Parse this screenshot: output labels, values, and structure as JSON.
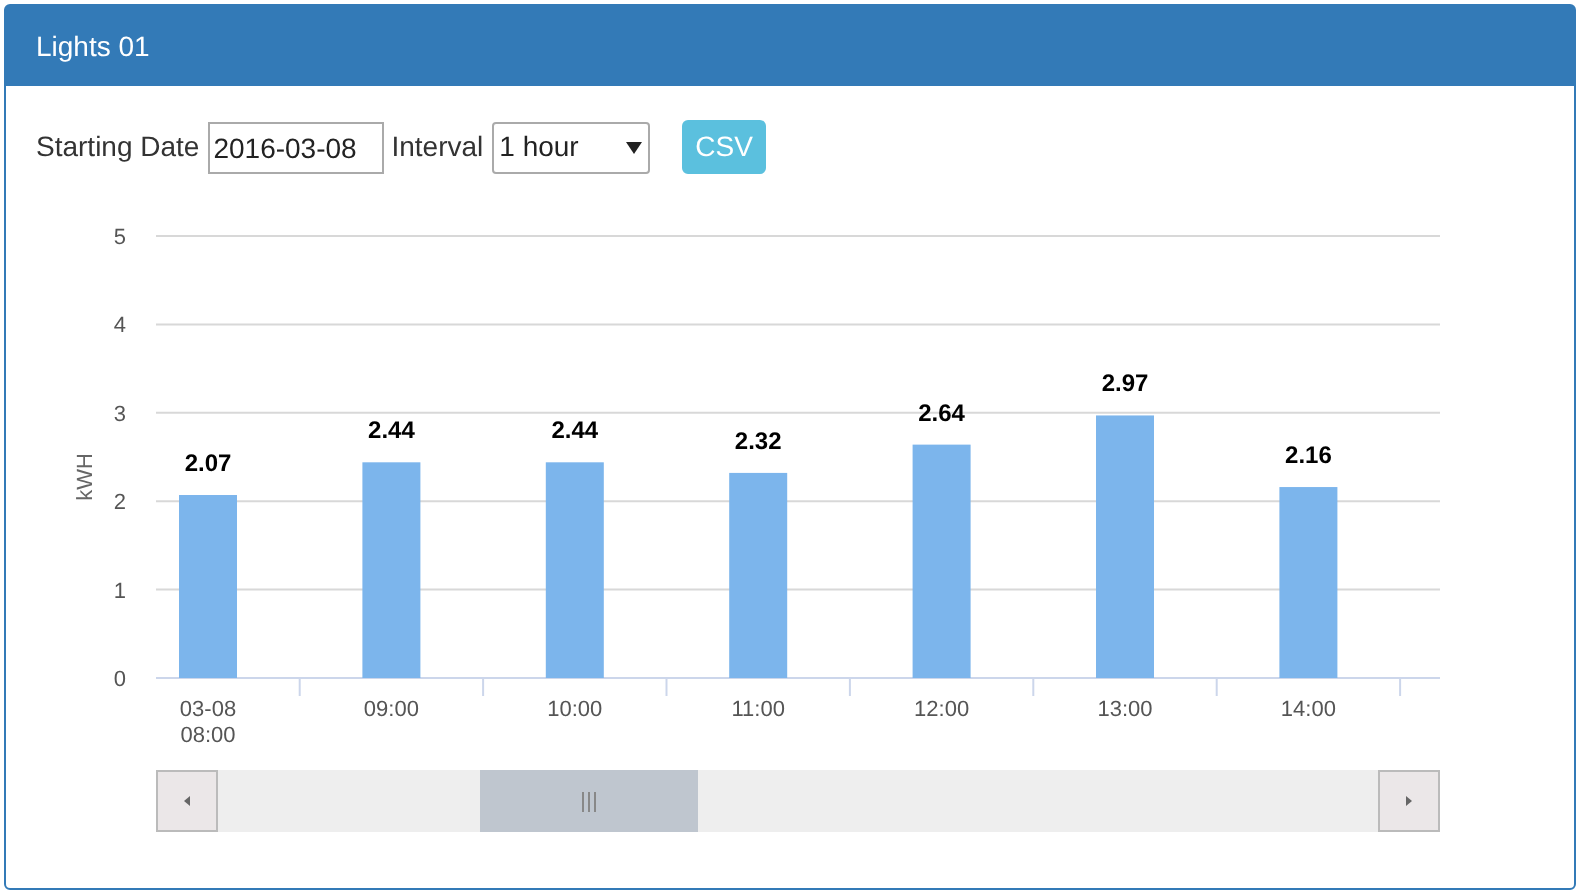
{
  "panel": {
    "title": "Lights 01"
  },
  "controls": {
    "date_label": "Starting Date",
    "date_value": "2016-03-08",
    "interval_label": "Interval",
    "interval_value": "1 hour",
    "csv_button": "CSV"
  },
  "chart_data": {
    "type": "bar",
    "ylabel": "kWH",
    "categories": [
      "03-08 08:00",
      "09:00",
      "10:00",
      "11:00",
      "12:00",
      "13:00",
      "14:00"
    ],
    "series": [
      {
        "color": "#7cb5ec",
        "values": [
          2.07,
          2.44,
          2.44,
          2.32,
          2.64,
          2.97,
          2.16
        ]
      }
    ],
    "ylim": [
      0,
      5
    ],
    "yticks": [
      0,
      1,
      2,
      3,
      4,
      5
    ],
    "data_labels": true,
    "grid": true
  }
}
